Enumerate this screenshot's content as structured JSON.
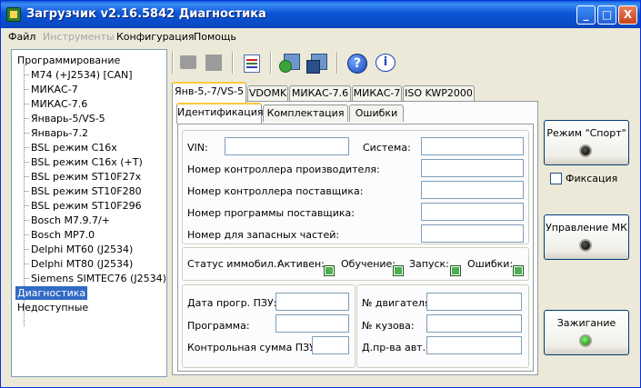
{
  "window": {
    "title": "Загрузчик v2.16.5842 Диагностика",
    "controls": {
      "minimize": "_",
      "maximize": "□",
      "close": "X"
    }
  },
  "menu": {
    "items": [
      {
        "label": "Файл",
        "enabled": true
      },
      {
        "label": "Инструменты",
        "enabled": false
      },
      {
        "label": "Конфигурация",
        "enabled": true
      },
      {
        "label": "Помощь",
        "enabled": true
      }
    ]
  },
  "tree": {
    "root": "Программирование",
    "children": [
      "М74 (+J2534) [CAN]",
      "МИКАС-7",
      "МИКАС-7.6",
      "Январь-5/VS-5",
      "Январь-7.2",
      "BSL режим C16x",
      "BSL режим C16x (+T)",
      "BSL режим ST10F27x",
      "BSL режим ST10F280",
      "BSL режим ST10F296",
      "Bosch M7.9.7/+",
      "Bosch MP7.0",
      "Delphi MT60 (J2534)",
      "Delphi MT80 (J2534)",
      "Siemens SIMTEC76 (J2534)"
    ],
    "diagnostics": "Диагностика",
    "unavailable": "Недоступные"
  },
  "toolbar": {
    "icons": [
      "open-folder-icon",
      "save-icon",
      "edit-checklist-icon",
      "refresh-icon",
      "save-disk-icon",
      "help-icon",
      "info-icon"
    ]
  },
  "ecu_tabs": [
    {
      "label": "Янв-5,-7/VS-5",
      "active": true
    },
    {
      "label": "VDOMK",
      "active": false
    },
    {
      "label": "МИКАС-7.6",
      "active": false
    },
    {
      "label": "МИКАС-7",
      "active": false
    },
    {
      "label": "ISO KWP2000",
      "active": false
    }
  ],
  "sub_tabs": [
    {
      "label": "Идентификация",
      "active": true
    },
    {
      "label": "Комплектация",
      "active": false
    },
    {
      "label": "Ошибки",
      "active": false
    }
  ],
  "ident": {
    "vin_label": "VIN:",
    "vin_value": "",
    "system_label": "Система:",
    "system_value": "",
    "ctrl_mfr_label": "Номер контроллера производителя:",
    "ctrl_mfr_value": "",
    "ctrl_sup_label": "Номер контроллера поставщика:",
    "ctrl_sup_value": "",
    "prog_sup_label": "Номер программы поставщика:",
    "prog_sup_value": "",
    "spare_label": "Номер для запасных частей:",
    "spare_value": ""
  },
  "immo": {
    "status_label": "Статус иммобил.:",
    "active_label": "Активен:",
    "learning_label": "Обучение:",
    "start_label": "Запуск:",
    "errors_label": "Ошибки:"
  },
  "rom": {
    "date_label": "Дата прогр. ПЗУ:",
    "date_value": "",
    "program_label": "Программа:",
    "program_value": "",
    "checksum_label": "Контрольная сумма ПЗУ:",
    "checksum_value": "",
    "engine_no_label": "№ двигателя:",
    "engine_no_value": "",
    "body_no_label": "№ кузова:",
    "body_no_value": "",
    "dpr_label": "Д.пр-ва авт.:",
    "dpr_value": ""
  },
  "side": {
    "sport_label": "Режим \"Спорт\"",
    "fix_label": "Фиксация",
    "mk_label": "Управление МК",
    "ignition_label": "Зажигание"
  }
}
